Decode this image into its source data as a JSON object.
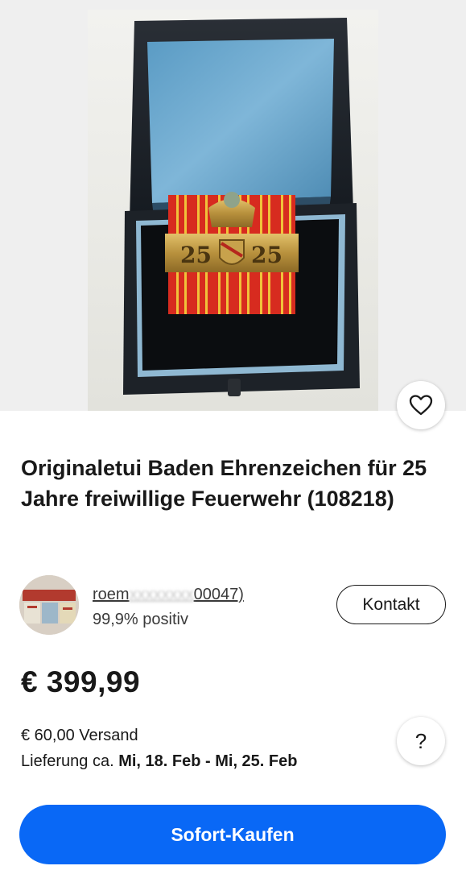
{
  "listing": {
    "title": "Originaletui Baden Ehrenzeichen für 25 Jahre freiwillige Feuerwehr (108218)",
    "image": {
      "medal_bar_numbers": "25 25"
    }
  },
  "seller": {
    "name_visible": "roem",
    "name_obscured": "xxxxxxxx",
    "feedback_count_suffix": "00047)",
    "rating": "99,9% positiv",
    "contact_label": "Kontakt"
  },
  "price": {
    "amount": "€ 399,99"
  },
  "shipping": {
    "cost": "€ 60,00 Versand",
    "delivery_prefix": "Lieferung ca.",
    "delivery_range": "Mi, 18. Feb - Mi, 25. Feb"
  },
  "help": {
    "label": "?"
  },
  "actions": {
    "buy_now_label": "Sofort-Kaufen"
  },
  "colors": {
    "buy_button": "#0968f6",
    "text": "#191919"
  },
  "icons": {
    "favorite": "heart-icon",
    "help": "question-icon"
  }
}
